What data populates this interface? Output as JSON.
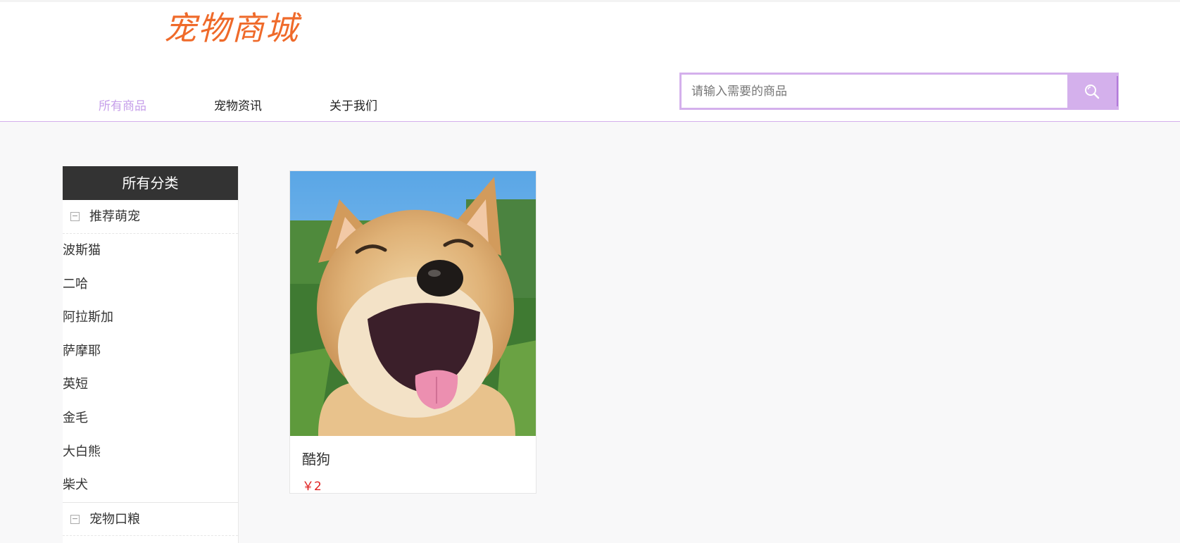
{
  "header": {
    "logo_text": "宠物商城",
    "nav": [
      {
        "label": "所有商品",
        "active": true
      },
      {
        "label": "宠物资讯",
        "active": false
      },
      {
        "label": "关于我们",
        "active": false
      }
    ],
    "search": {
      "placeholder": "请输入需要的商品",
      "value": "",
      "button_icon": "search-icon"
    }
  },
  "sidebar": {
    "title": "所有分类",
    "groups": [
      {
        "label": "推荐萌宠",
        "toggle": "⊟",
        "items": [
          "波斯猫",
          "二哈",
          "阿拉斯加",
          "萨摩耶",
          "英短",
          "金毛",
          "大白熊",
          "柴犬"
        ]
      },
      {
        "label": "宠物口粮",
        "toggle": "⊟",
        "items": []
      }
    ]
  },
  "products": [
    {
      "name": "酷狗",
      "price": "￥2",
      "image": "smiling shiba inu dog photo"
    }
  ],
  "colors": {
    "accent": "#d4b0ec",
    "active_nav": "#c7a0ea",
    "logo": "#ef6a2a",
    "price": "#e02020",
    "sidebar_title_bg": "#333333"
  }
}
